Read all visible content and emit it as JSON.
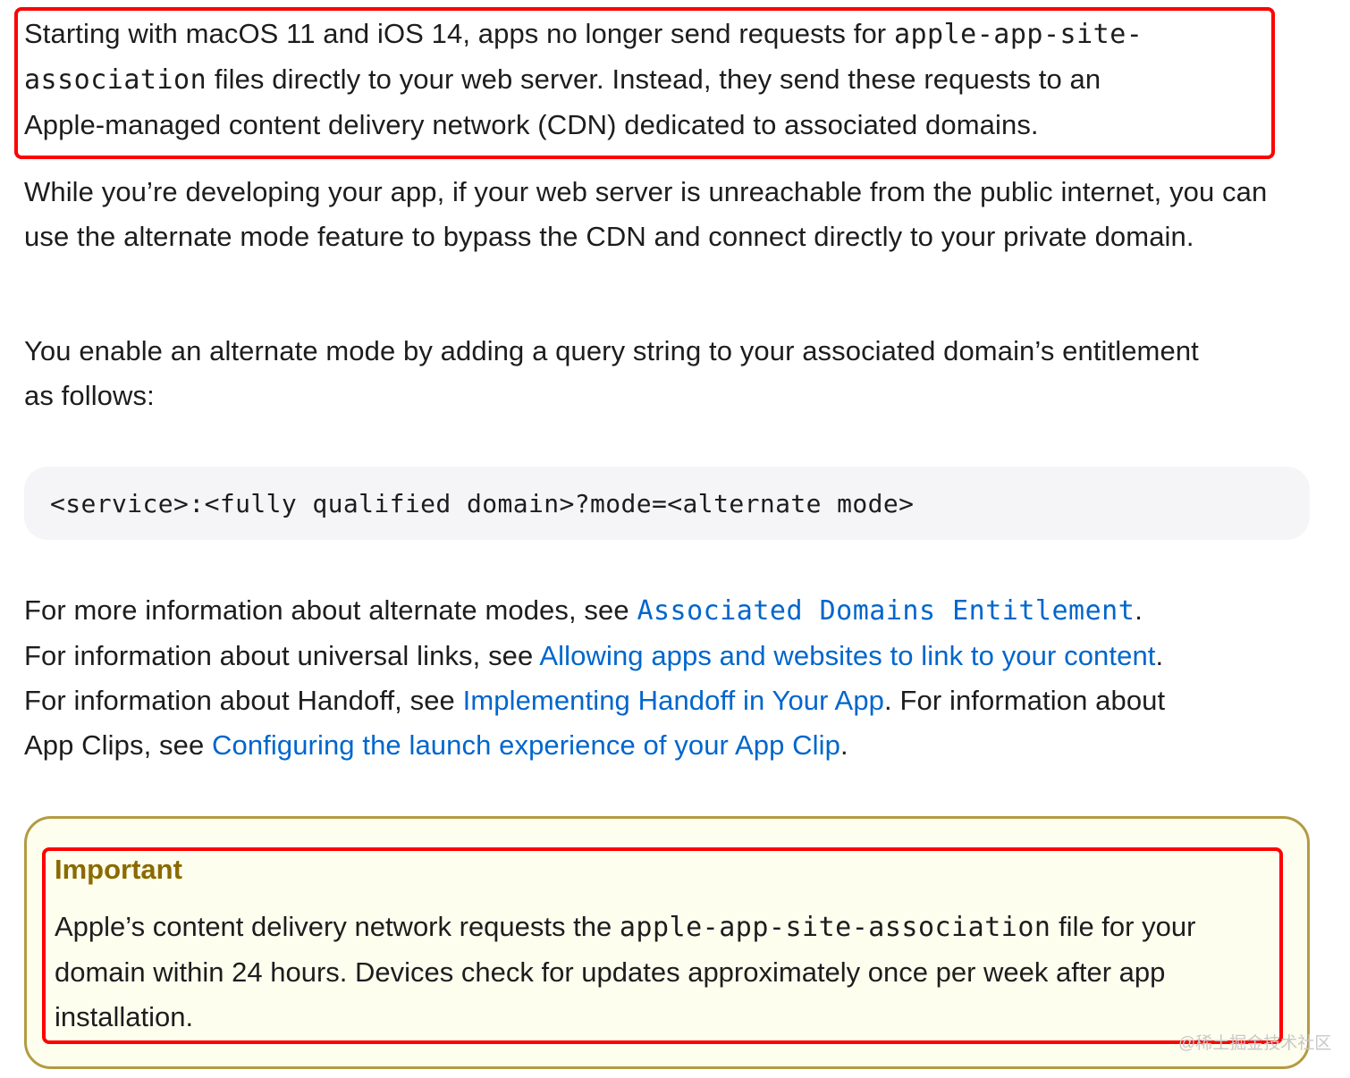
{
  "para1": {
    "t1": "Starting with macOS 11 and iOS 14, apps no longer send requests for ",
    "code1": "apple-app-site-",
    "code2": "association",
    "t2": " files directly to your web server. Instead, they send these requests to an",
    "t3": "Apple-managed content delivery network (CDN) dedicated to associated domains."
  },
  "para2": {
    "text": "While you’re developing your app, if your web server is unreachable from the public internet, you can use the alternate mode feature to bypass the CDN and connect directly to your private domain."
  },
  "para3": {
    "text": "You enable an alternate mode by adding a query string to your associated domain’s entitlement as follows:"
  },
  "code_block": {
    "text": "<service>:<fully qualified domain>?mode=<alternate mode>"
  },
  "para4": {
    "t1": "For more information about alternate modes, see ",
    "link1": "Associated Domains Entitlement",
    "t2": ".",
    "t3": "For information about universal links, see ",
    "link2": "Allowing apps and websites to link to your content",
    "t4": ".",
    "t5": "For information about Handoff, see ",
    "link3": "Implementing Handoff in Your App",
    "t6": ". For information about",
    "t7": "App Clips, see ",
    "link4": "Configuring the launch experience of your App Clip",
    "t8": "."
  },
  "important": {
    "title": "Important",
    "t1": "Apple’s content delivery network requests the ",
    "code": "apple-app-site-association",
    "t2": " file for your domain within 24 hours. Devices check for updates approximately once per week after app installation."
  },
  "watermark": "@稀土掘金技术社区",
  "colors": {
    "link": "#0066cc",
    "highlight_border": "#ff0000",
    "aside_border": "#b39b43",
    "aside_bg": "#fefeee",
    "aside_title": "#8a6a00",
    "code_bg": "#f5f5f7"
  }
}
